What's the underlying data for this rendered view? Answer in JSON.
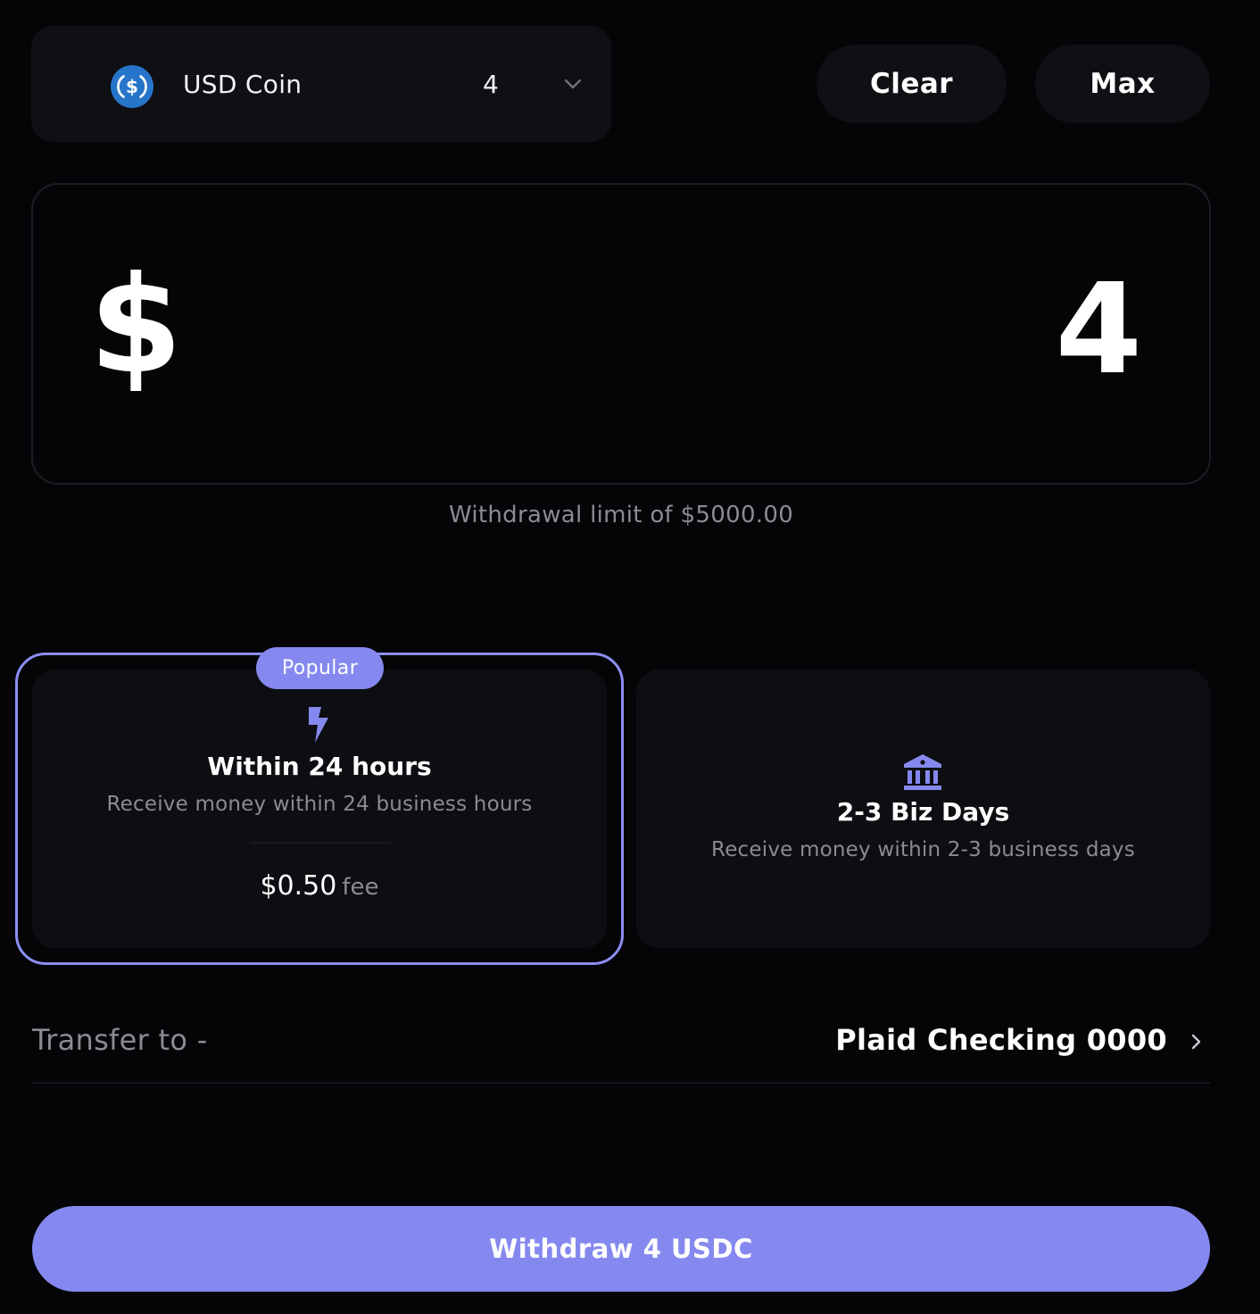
{
  "token_selector": {
    "icon": "usdc-coin-icon",
    "name": "USD Coin",
    "amount": "4"
  },
  "actions": {
    "clear_label": "Clear",
    "max_label": "Max"
  },
  "amount_input": {
    "currency_symbol": "$",
    "value": "4"
  },
  "limit_text": "Withdrawal limit of $5000.00",
  "speed_options": {
    "fast": {
      "badge": "Popular",
      "icon": "lightning-bolt-icon",
      "title": "Within 24 hours",
      "description": "Receive money within 24 business hours",
      "fee_amount": "$0.50",
      "fee_label": "fee",
      "selected": true
    },
    "standard": {
      "icon": "bank-icon",
      "title": "2-3 Biz Days",
      "description": "Receive money within 2-3 business days",
      "selected": false
    }
  },
  "transfer": {
    "label": "Transfer to -",
    "account": "Plaid Checking 0000"
  },
  "withdraw_button": "Withdraw 4 USDC",
  "colors": {
    "accent": "#8589ef",
    "background": "#050507",
    "card": "#0f1014",
    "muted_text": "#8a8b93",
    "usdc_blue": "#2775ca"
  }
}
